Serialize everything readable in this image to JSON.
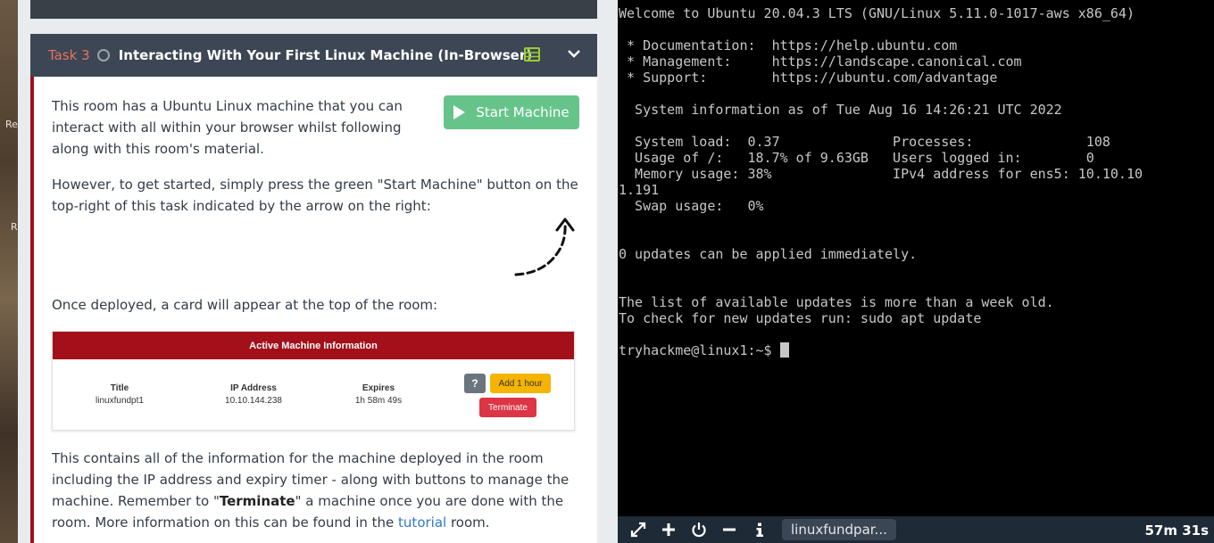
{
  "desktop": {
    "fragments": [
      "Re",
      "R"
    ]
  },
  "task": {
    "number": "Task 3",
    "title": "Interacting With Your First Linux Machine (In-Browser)",
    "start_button": "Start Machine",
    "p1": "This room has a Ubuntu Linux machine that you can interact with all within your browser whilst following along with this room's material.",
    "p2": "However, to get started, simply press the green \"Start Machine\" button on the top-right of this task indicated by the arrow on the right:",
    "p3": "Once deployed, a card will appear at the top of the room:",
    "p4_a": "This contains all of the information for the machine deployed in the room including the IP address and expiry timer - along with buttons to manage the machine. Remember to \"",
    "p4_term": "Terminate",
    "p4_b": "\" a machine once you are done with the room. More information on this can be found in the ",
    "p4_link": "tutorial",
    "p4_c": " room."
  },
  "example_card": {
    "header": "Active Machine Information",
    "title_label": "Title",
    "title_value": "linuxfundpt1",
    "ip_label": "IP Address",
    "ip_value": "10.10.144.238",
    "expires_label": "Expires",
    "expires_value": "1h 58m 49s",
    "help_button": "?",
    "add_button": "Add 1 hour",
    "terminate_button": "Terminate"
  },
  "terminal": {
    "lines": [
      "Welcome to Ubuntu 20.04.3 LTS (GNU/Linux 5.11.0-1017-aws x86_64)",
      "",
      " * Documentation:  https://help.ubuntu.com",
      " * Management:     https://landscape.canonical.com",
      " * Support:        https://ubuntu.com/advantage",
      "",
      "  System information as of Tue Aug 16 14:26:21 UTC 2022",
      "",
      "  System load:  0.37              Processes:              108",
      "  Usage of /:   18.7% of 9.63GB   Users logged in:        0",
      "  Memory usage: 38%               IPv4 address for ens5: 10.10.10",
      "1.191",
      "  Swap usage:   0%",
      "",
      "",
      "0 updates can be applied immediately.",
      "",
      "",
      "The list of available updates is more than a week old.",
      "To check for new updates run: sudo apt update",
      "",
      "tryhackme@linux1:~$ "
    ]
  },
  "toolbar": {
    "tab_label": "linuxfundpar...",
    "timer": "57m 31s",
    "icons": [
      "expand-icon",
      "plus-icon",
      "power-icon",
      "minus-icon",
      "info-icon"
    ]
  },
  "colors": {
    "accent_red": "#a3101a",
    "start_green": "#66c48a",
    "header_bg": "#3d4654",
    "link_blue": "#2f7ac3"
  }
}
